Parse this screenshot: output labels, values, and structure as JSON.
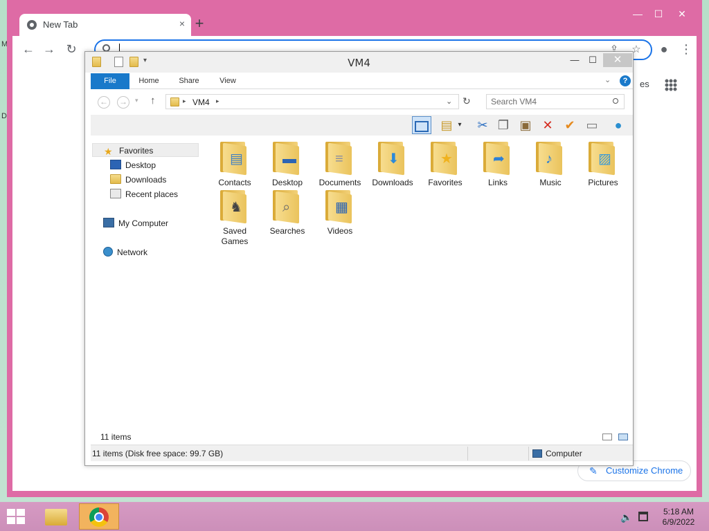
{
  "desktop": {
    "fragments": [
      "M",
      "D"
    ]
  },
  "chrome": {
    "tab_title": "New Tab",
    "tab_close": "×",
    "new_tab": "+",
    "window_controls": {
      "minimize": "—",
      "maximize": "☐",
      "close": "✕"
    },
    "nav": {
      "back": "←",
      "forward": "→",
      "reload": "↻",
      "share": "⇪",
      "star": "☆",
      "profile": "●",
      "menu": "⋮"
    },
    "ntp_partial_text": "es",
    "customize_label": "Customize Chrome"
  },
  "explorer": {
    "title": "VM4",
    "window_controls": {
      "minimize": "—",
      "maximize": "☐",
      "close": "✕"
    },
    "ribbon_tabs": [
      "File",
      "Home",
      "Share",
      "View"
    ],
    "help": "?",
    "address": {
      "crumb": "VM4",
      "separator": "▸"
    },
    "search_placeholder": "Search VM4",
    "toolbar_icons": [
      "layout-pane-icon",
      "properties-icon",
      "cut-icon",
      "copy-icon",
      "paste-icon",
      "delete-icon",
      "select-icon",
      "rename-icon",
      "globe-icon"
    ],
    "nav_pane": {
      "favorites": "Favorites",
      "desktop": "Desktop",
      "downloads": "Downloads",
      "recent": "Recent places",
      "computer": "My Computer",
      "network": "Network"
    },
    "items": [
      {
        "name": "Contacts",
        "glyph": "▤",
        "glyph_color": "#3f7fc4"
      },
      {
        "name": "Desktop",
        "glyph": "▬",
        "glyph_color": "#2c64b4"
      },
      {
        "name": "Documents",
        "glyph": "≡",
        "glyph_color": "#8a8fa0"
      },
      {
        "name": "Downloads",
        "glyph": "⬇",
        "glyph_color": "#2d8ad8"
      },
      {
        "name": "Favorites",
        "glyph": "★",
        "glyph_color": "#f0b21e"
      },
      {
        "name": "Links",
        "glyph": "➦",
        "glyph_color": "#2d80d6"
      },
      {
        "name": "Music",
        "glyph": "♪",
        "glyph_color": "#2d80d6"
      },
      {
        "name": "Pictures",
        "glyph": "▨",
        "glyph_color": "#3a9ad8"
      },
      {
        "name": "Saved Games",
        "glyph": "♞",
        "glyph_color": "#444444"
      },
      {
        "name": "Searches",
        "glyph": "⌕",
        "glyph_color": "#6a6a6a"
      },
      {
        "name": "Videos",
        "glyph": "▦",
        "glyph_color": "#2c64b4"
      }
    ],
    "items_count": "11 items",
    "status_left": "11 items (Disk free space: 99.7 GB)",
    "status_right": "Computer"
  },
  "taskbar": {
    "time": "5:18 AM",
    "date": "6/9/2022"
  },
  "colors": {
    "chrome_frame": "#de6ba5",
    "taskbar": "#d69ac3",
    "explorer_file_tab": "#1979ca",
    "accent_blue": "#1a73e8"
  }
}
